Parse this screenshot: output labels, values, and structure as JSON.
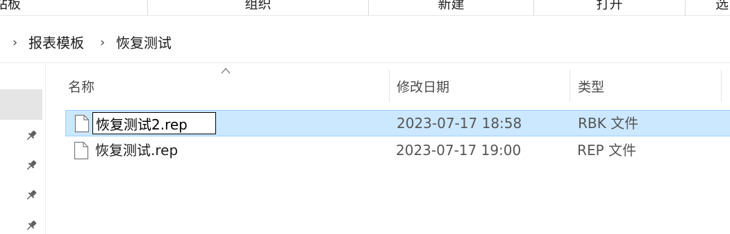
{
  "ribbon": {
    "groups": [
      "站板",
      "组织",
      "新建",
      "打开",
      "选"
    ]
  },
  "breadcrumb": {
    "items": [
      "报表模板",
      "恢复测试"
    ]
  },
  "columns": {
    "name": "名称",
    "date_modified": "修改日期",
    "type": "类型"
  },
  "files": [
    {
      "name": "恢复测试2.rep",
      "date": "2023-07-17 18:58",
      "type": "RBK 文件",
      "selected": true,
      "renaming": true
    },
    {
      "name": "恢复测试.rep",
      "date": "2023-07-17 19:00",
      "type": "REP 文件",
      "selected": false,
      "renaming": false
    }
  ],
  "colors": {
    "selection_bg": "#cce8ff",
    "selection_border": "#99d1ff"
  },
  "icons": {
    "pins": [
      "pin-icon",
      "pin-icon",
      "pin-icon",
      "pin-icon"
    ],
    "file": "file-icon",
    "sort": "sort-ascending-icon"
  }
}
